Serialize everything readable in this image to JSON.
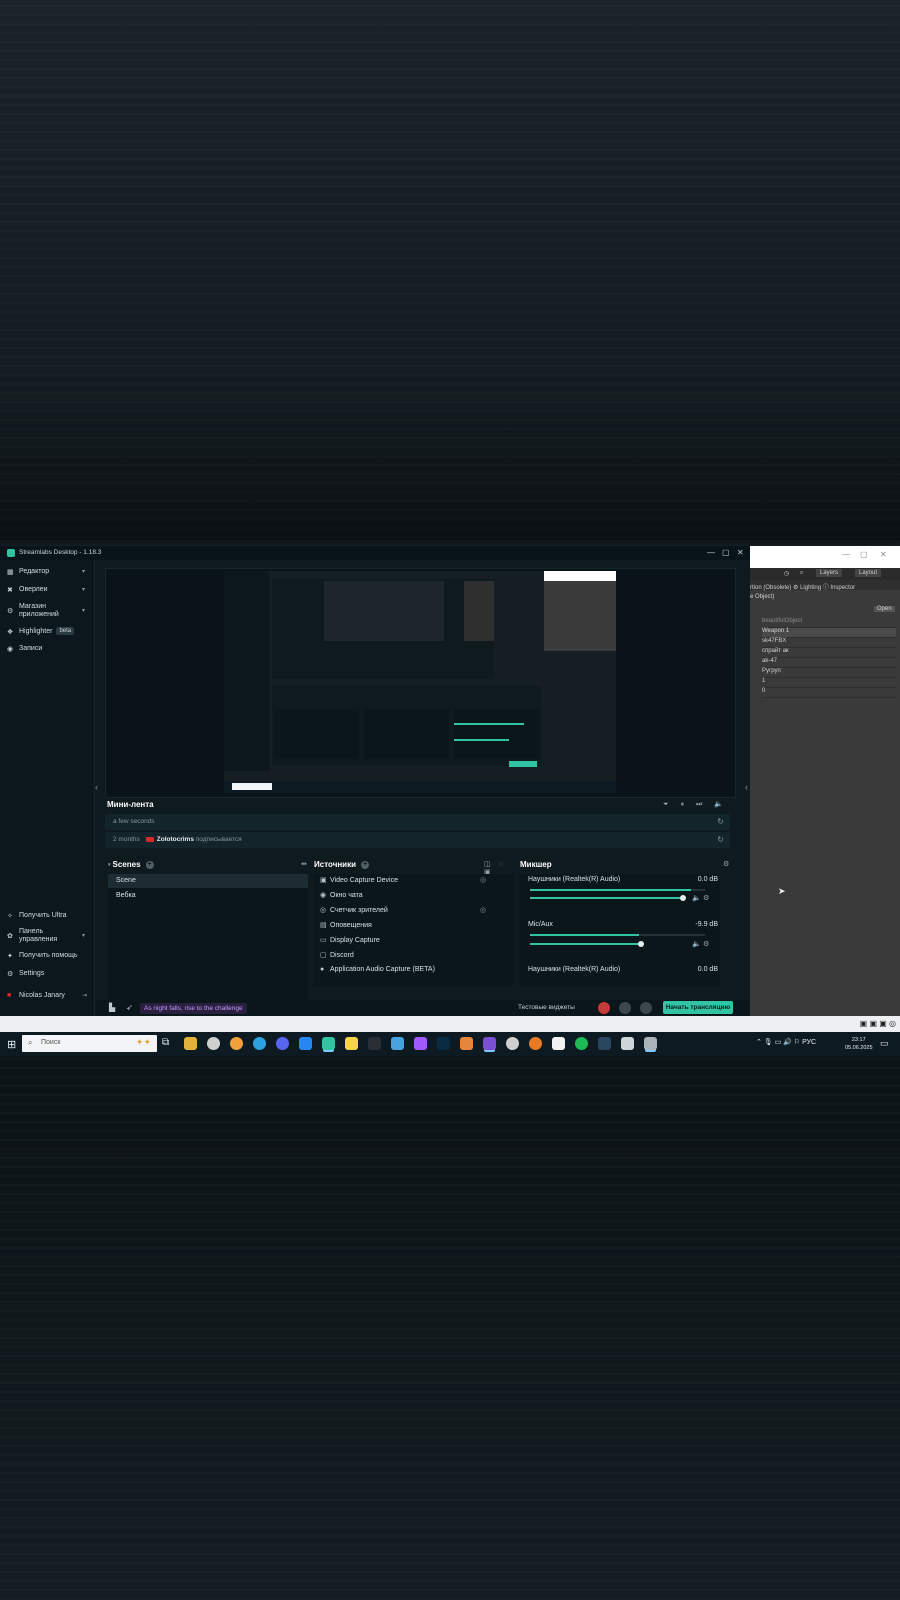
{
  "window": {
    "title": "Streamlabs Desktop - 1.18.3",
    "min": "—",
    "max": "▢",
    "close": "✕"
  },
  "sidebar": {
    "items": [
      {
        "label": "Редактор",
        "icon": "editor-icon"
      },
      {
        "label": "Оверлеи",
        "icon": "overlays-icon"
      },
      {
        "label": "Магазин приложений",
        "icon": "app-store-icon"
      },
      {
        "label": "Highlighter",
        "icon": "highlighter-icon",
        "badge": "beta"
      },
      {
        "label": "Записи",
        "icon": "recordings-icon"
      }
    ],
    "bottom": [
      {
        "label": "Получить Ultra",
        "icon": "ultra-icon"
      },
      {
        "label": "Панель управления",
        "icon": "dashboard-icon"
      },
      {
        "label": "Получить помощь",
        "icon": "help-icon"
      },
      {
        "label": "Settings",
        "icon": "settings-icon"
      }
    ],
    "user": "Nicolas Janary"
  },
  "feed": {
    "title": "Мини-лента",
    "rows": [
      {
        "time": "a few seconds",
        "user": "",
        "action": ""
      },
      {
        "time": "2 months",
        "user": "Zolotocrims",
        "action": "подписывается"
      }
    ]
  },
  "scenes": {
    "title": "Scenes",
    "items": [
      "Scene",
      "Вебка"
    ]
  },
  "sources": {
    "title": "Источники",
    "items": [
      {
        "label": "Video Capture Device",
        "icon": "camera-icon"
      },
      {
        "label": "Окно чата",
        "icon": "chat-icon"
      },
      {
        "label": "Счетчик зрителей",
        "icon": "eye-icon"
      },
      {
        "label": "Оповещения",
        "icon": "alert-icon"
      },
      {
        "label": "Display Capture",
        "icon": "monitor-icon"
      },
      {
        "label": "Discord",
        "icon": "window-icon"
      },
      {
        "label": "Application Audio Capture (BETA)",
        "icon": "user-icon"
      }
    ]
  },
  "mixer": {
    "title": "Микшер",
    "channels": [
      {
        "name": "Наушники (Realtek(R) Audio)",
        "db": "0.0 dB",
        "level": 0.92
      },
      {
        "name": "Mic/Aux",
        "db": "-9.9 dB",
        "level": 0.62
      },
      {
        "name": "Наушники (Realtek(R) Audio)",
        "db": "0.0 dB",
        "level": 0.92
      }
    ]
  },
  "bottombar": {
    "challenge": "As night falls, rise to the challenge",
    "test_widgets": "Тестовые виджеты",
    "start": "Начать трансляцию"
  },
  "unity": {
    "tabs": "rtion (Obsolete)   ⚙ Lighting   ⓘ Inspector",
    "layers": "Layers",
    "layout": "Layout",
    "subtitle": "e Object)",
    "open": "Open",
    "rows": [
      "beautifulObject",
      "Weapon 1",
      "sk47FBX",
      "спрайт ак",
      "ak-47",
      "Ругруп",
      "1",
      "0"
    ]
  },
  "taskbar": {
    "search_placeholder": "Поиск",
    "lang": "РУС",
    "time": "23:17",
    "date": "05.06.2025"
  },
  "colors": {
    "accent": "#31c3a2",
    "app_bg": "#0f1a1e",
    "sidebar_bg": "#0b171c"
  }
}
